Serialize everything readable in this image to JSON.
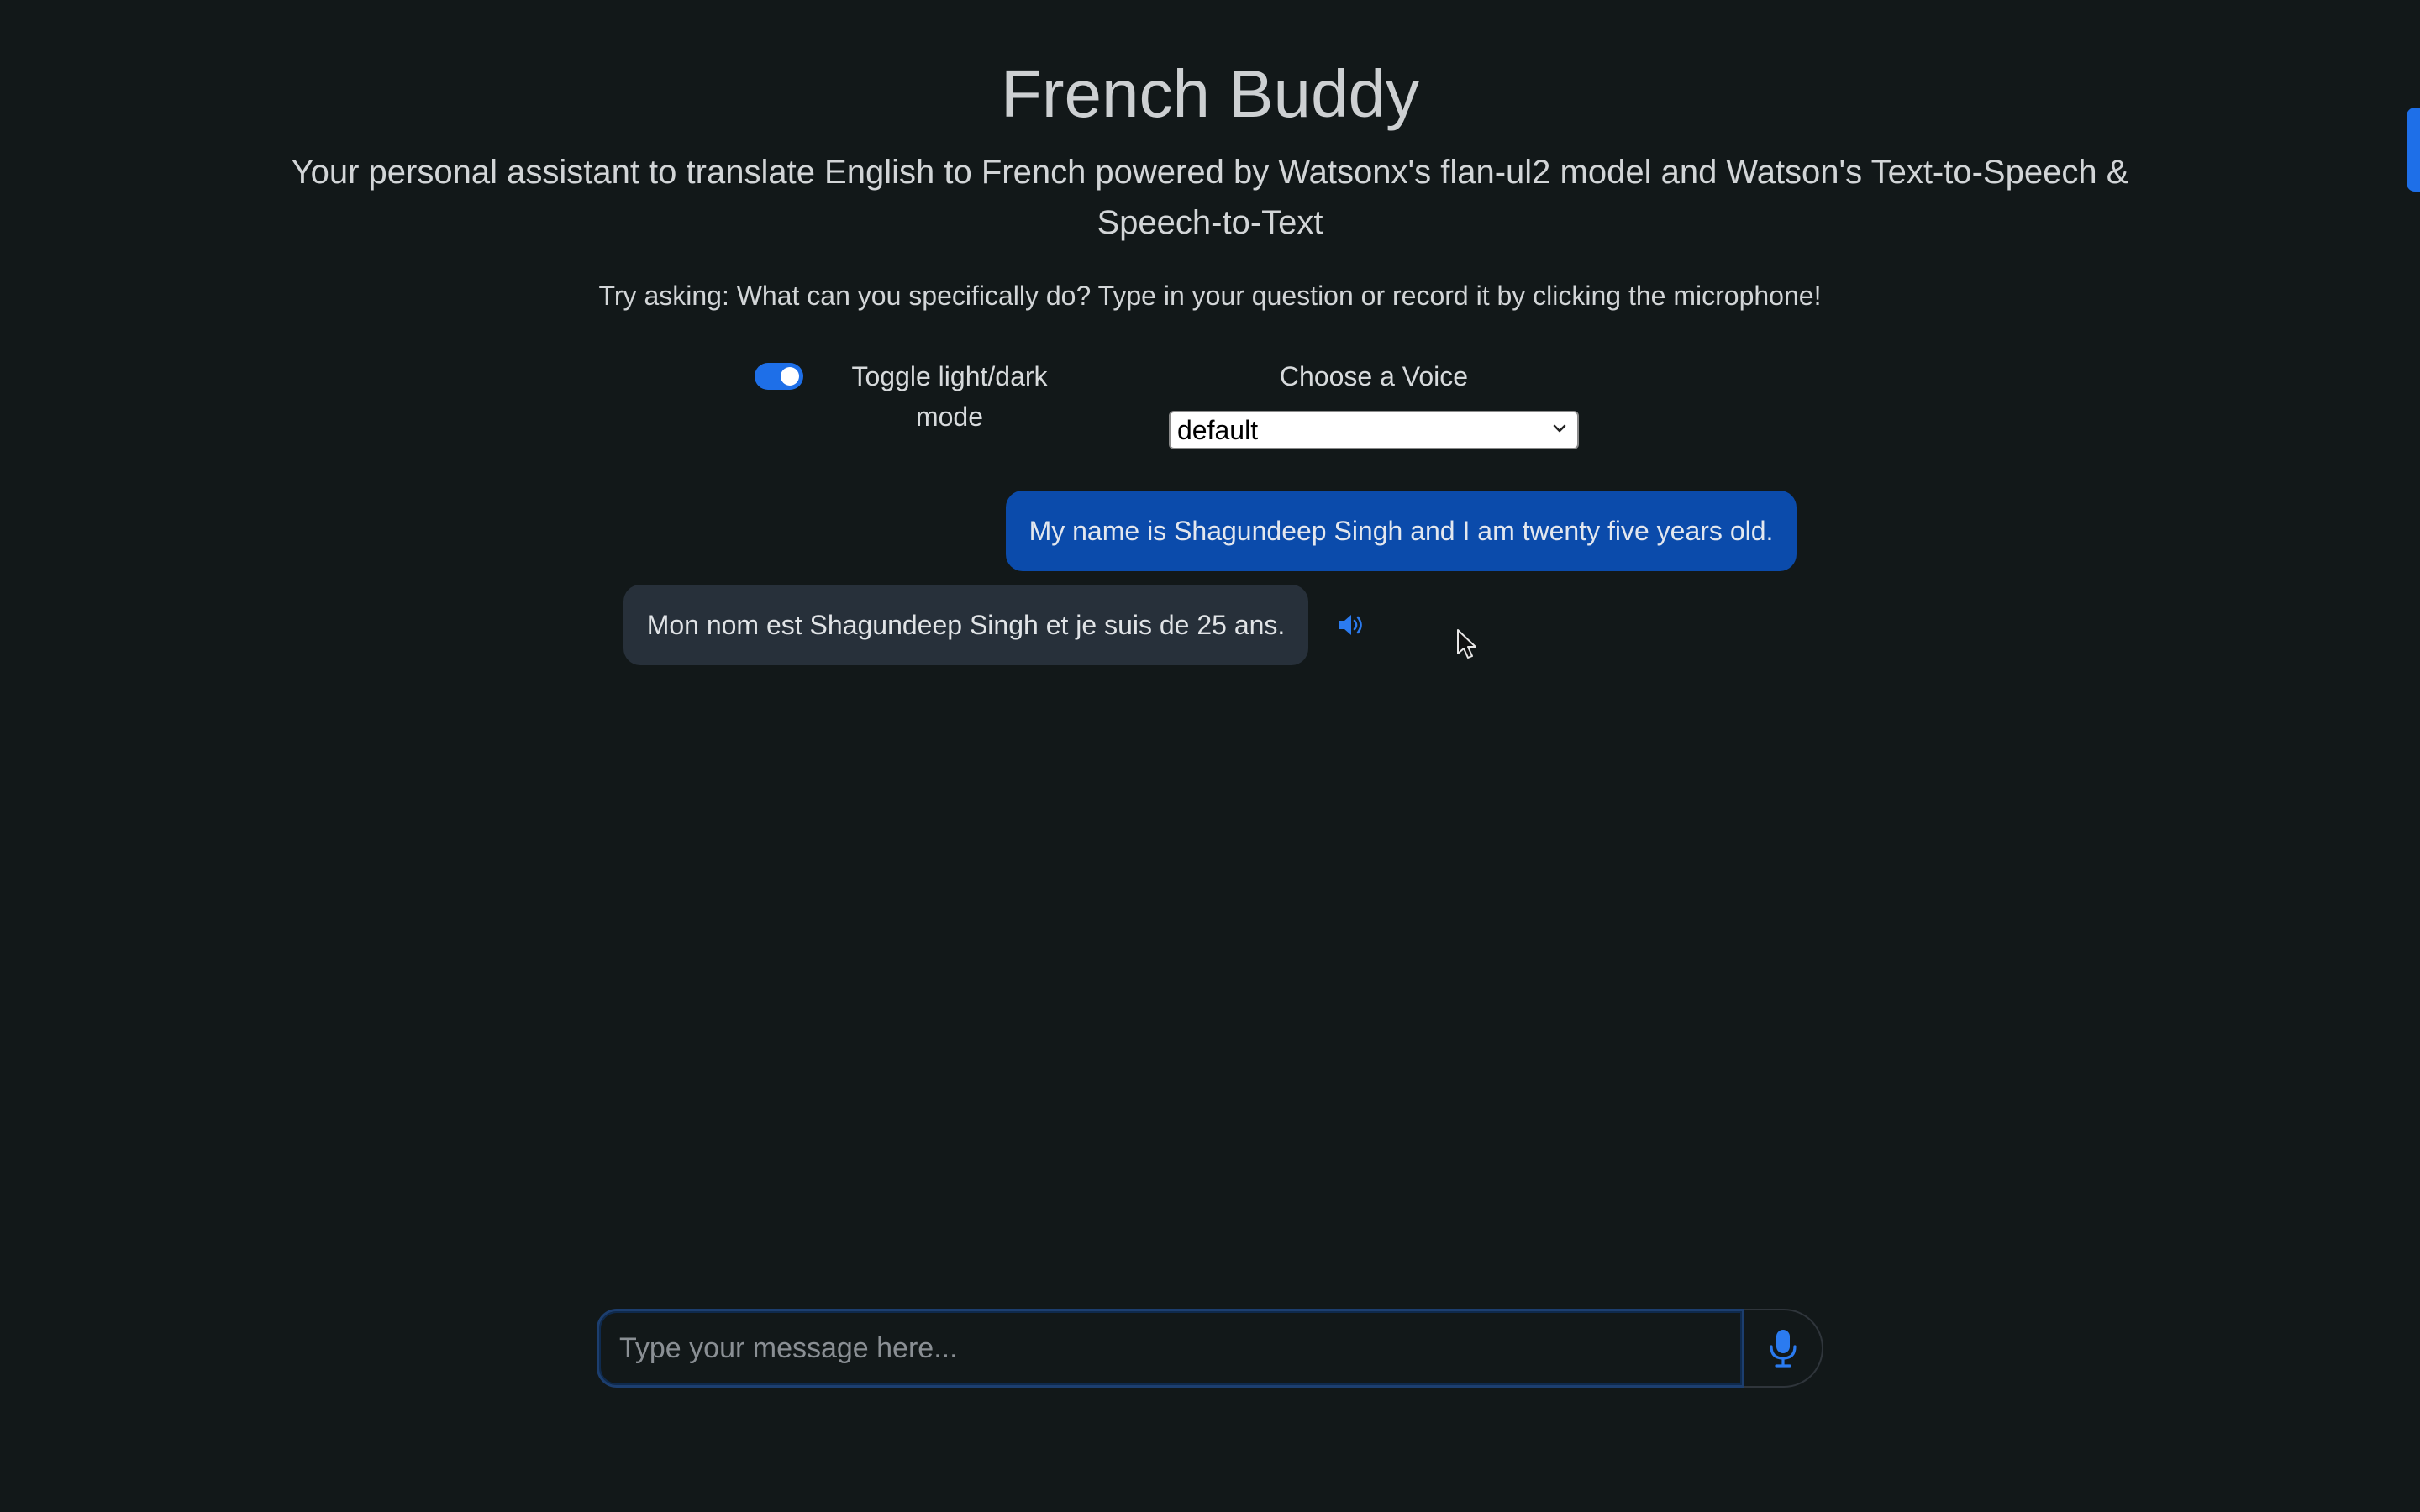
{
  "header": {
    "title": "French Buddy",
    "subtitle": "Your personal assistant to translate English to French powered by Watsonx's flan-ul2 model and Watson's Text-to-Speech & Speech-to-Text",
    "hint": "Try asking: What can you specifically do? Type in your question or record it by clicking the microphone!"
  },
  "controls": {
    "theme_toggle": {
      "label": "Toggle light/dark mode",
      "checked": true
    },
    "voice": {
      "label": "Choose a Voice",
      "selected": "default"
    }
  },
  "chat": {
    "messages": [
      {
        "role": "user",
        "text": "My name is Shagundeep Singh and I am twenty five years old."
      },
      {
        "role": "bot",
        "text": "Mon nom est Shagundeep Singh et je suis de 25 ans."
      }
    ]
  },
  "composer": {
    "placeholder": "Type your message here..."
  },
  "icons": {
    "speaker": "speaker-icon",
    "mic": "microphone-icon",
    "chevron": "chevron-down-icon"
  },
  "colors": {
    "background": "#121819",
    "accent": "#1e6fe8",
    "user_bubble": "#0b4bab",
    "bot_bubble": "#27303a"
  }
}
